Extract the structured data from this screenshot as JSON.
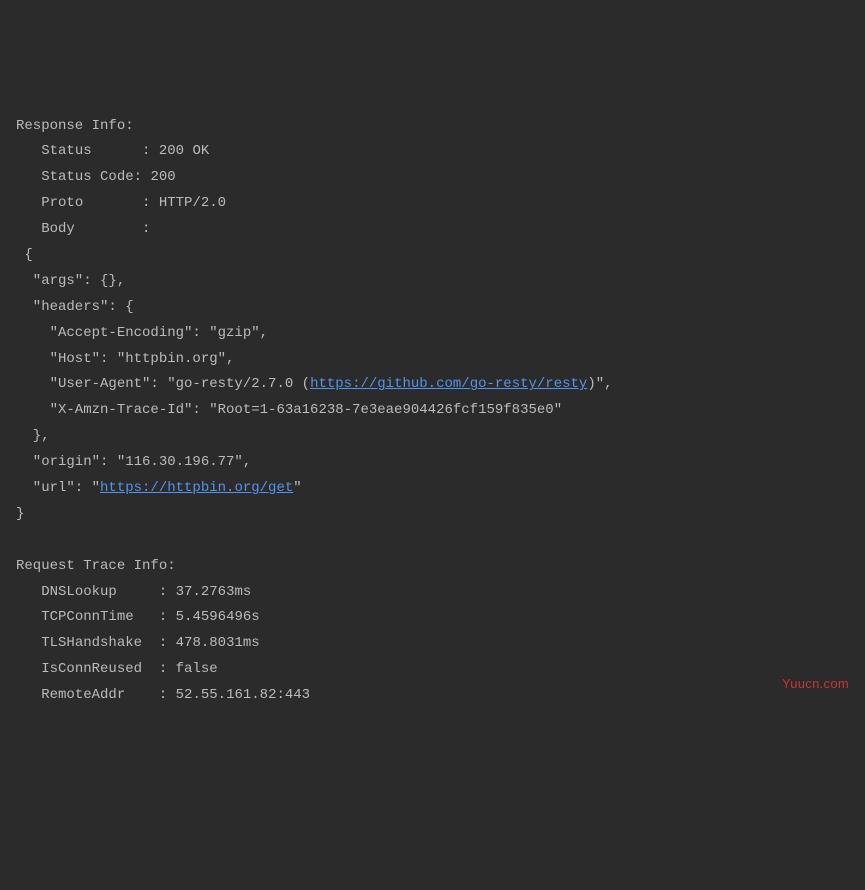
{
  "response": {
    "header": "Response Info:",
    "status_label": "Status      :",
    "status_value": "200 OK",
    "status_code_label": "Status Code:",
    "status_code_value": "200",
    "proto_label": "Proto       :",
    "proto_value": "HTTP/2.0",
    "body_label": "Body        :"
  },
  "body": {
    "open_brace": " {",
    "args_line": "  \"args\": {},",
    "headers_open": "  \"headers\": {",
    "accept_encoding": "    \"Accept-Encoding\": \"gzip\",",
    "host": "    \"Host\": \"httpbin.org\",",
    "user_agent_prefix": "    \"User-Agent\": \"go-resty/2.7.0 (",
    "user_agent_link": "https://github.com/go-resty/resty",
    "user_agent_suffix": ")\",",
    "trace_id": "    \"X-Amzn-Trace-Id\": \"Root=1-63a16238-7e3eae904426fcf159f835e0\"",
    "headers_close": "  },",
    "origin": "  \"origin\": \"116.30.196.77\",",
    "url_prefix": "  \"url\": \"",
    "url_link": "https://httpbin.org/get",
    "url_suffix": "\"",
    "close_brace": "}"
  },
  "trace": {
    "header": "Request Trace Info:",
    "dns_label": "DNSLookup     :",
    "dns_value": "37.2763ms",
    "tcp_label": "TCPConnTime   :",
    "tcp_value": "5.4596496s",
    "tls_label": "TLSHandshake  :",
    "tls_value": "478.8031ms",
    "reused_label": "IsConnReused  :",
    "reused_value": "false",
    "remote_label": "RemoteAddr    :",
    "remote_value": "52.55.161.82:443"
  },
  "watermark": "Yuucn.com"
}
